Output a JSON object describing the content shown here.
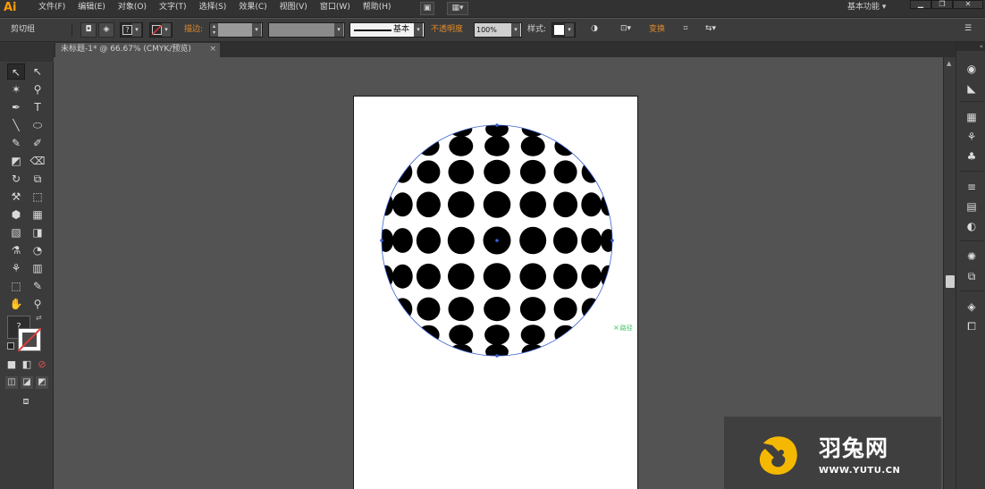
{
  "app": {
    "logo": "Ai"
  },
  "menu": {
    "items": [
      "文件(F)",
      "编辑(E)",
      "对象(O)",
      "文字(T)",
      "选择(S)",
      "效果(C)",
      "视图(V)",
      "窗口(W)",
      "帮助(H)"
    ],
    "workspace": "基本功能",
    "workspace_arrow": "▾"
  },
  "window_controls": {
    "minimize": "▁",
    "restore": "❐",
    "close": "✕"
  },
  "control_bar": {
    "selection_label": "剪切组",
    "stroke_label": "描边:",
    "stroke_profile": "基本",
    "opacity_label": "不透明度",
    "opacity_value": "100%",
    "style_label": "样式:",
    "transform_label": "变换"
  },
  "document_tab": {
    "title": "未标题-1* @ 66.67% (CMYK/预览)",
    "close": "×"
  },
  "tools": {
    "rows": [
      [
        "↖",
        "↖"
      ],
      [
        "✶",
        "⚲"
      ],
      [
        "✒",
        "T"
      ],
      [
        "╲",
        "⬭"
      ],
      [
        "✎",
        "✐"
      ],
      [
        "◩",
        "⌫"
      ],
      [
        "↻",
        "⧉"
      ],
      [
        "⚒",
        "⬚"
      ],
      [
        "⬢",
        "▦"
      ],
      [
        "▧",
        "◨"
      ],
      [
        "⚗",
        "◔"
      ],
      [
        "⚘",
        "▥"
      ],
      [
        "⬚",
        "✎"
      ],
      [
        "✋",
        "⚲"
      ]
    ],
    "fill_label": "?",
    "modes": [
      "■",
      "◧",
      "⊘"
    ]
  },
  "canvas": {
    "path_label": "路径",
    "path_marker": "×",
    "dot_color": "#000000",
    "circle_stroke": "#3a5fcd"
  },
  "dock": {
    "icons": [
      "◉",
      "◣",
      "▦",
      "⚘",
      "♣",
      "≡",
      "▤",
      "◐",
      "✺",
      "⧉",
      "◈",
      "⧠"
    ]
  },
  "watermark": {
    "title": "羽兔网",
    "url": "WWW.YUTU.CN",
    "accent": "#f5b800"
  }
}
